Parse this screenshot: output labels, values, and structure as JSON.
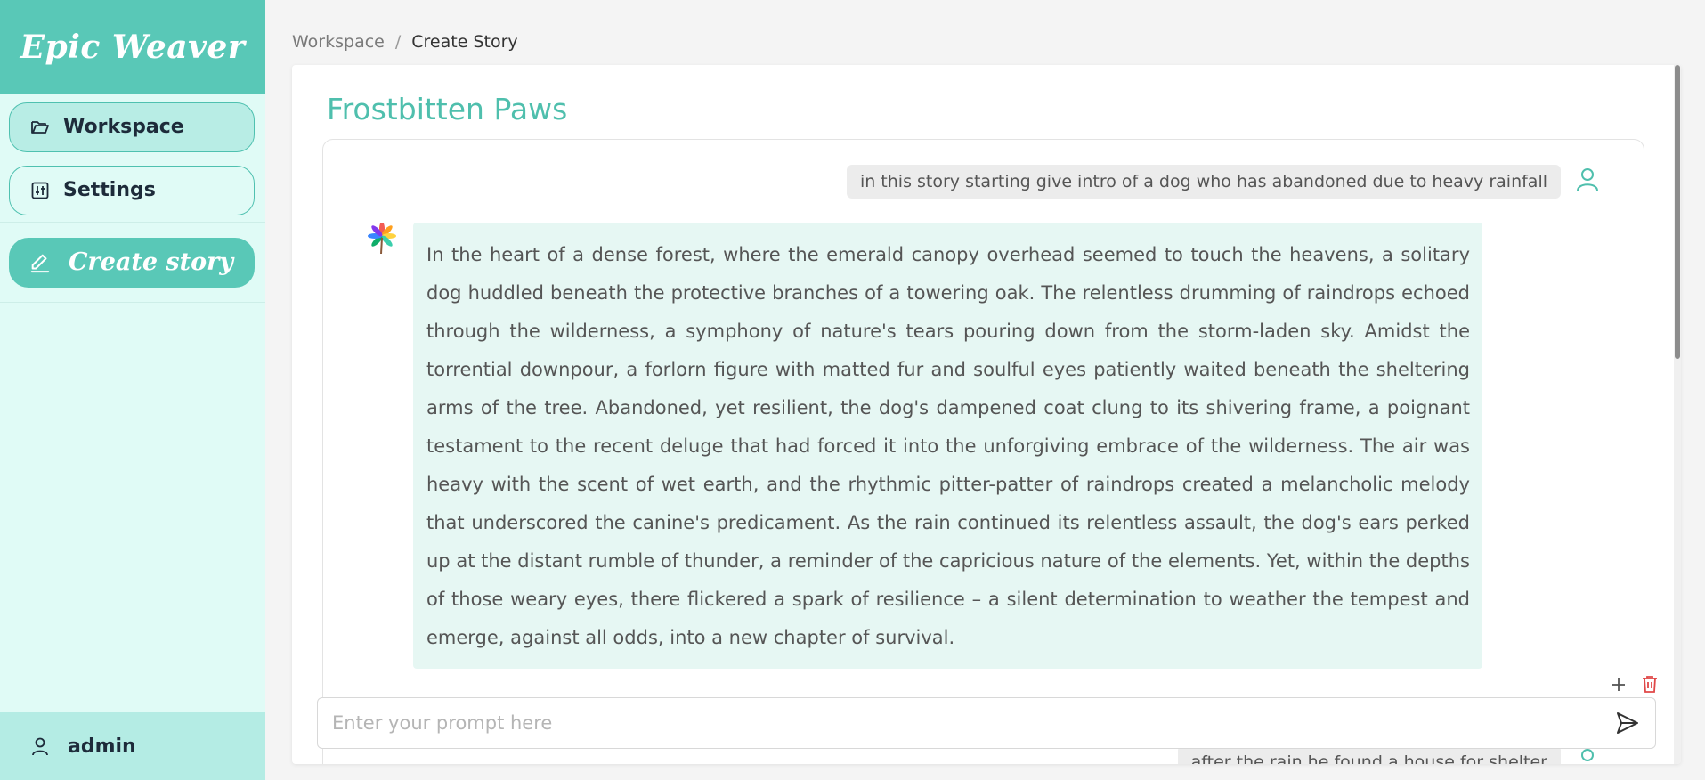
{
  "app": {
    "name": "Epic Weaver"
  },
  "sidebar": {
    "items": [
      {
        "label": "Workspace",
        "icon": "folder-open-icon",
        "active": true
      },
      {
        "label": "Settings",
        "icon": "sliders-icon",
        "active": false
      },
      {
        "label": "Create story",
        "icon": "pencil-icon",
        "active": false
      }
    ],
    "user": {
      "label": "admin",
      "icon": "user-icon"
    }
  },
  "breadcrumb": {
    "parent": "Workspace",
    "separator": "/",
    "current": "Create Story"
  },
  "story": {
    "title": "Frostbitten Paws"
  },
  "chat": {
    "messages": [
      {
        "role": "user",
        "text": "in this story starting give intro of a dog who has abandoned due to heavy rainfall"
      },
      {
        "role": "assistant",
        "text": "In the heart of a dense forest, where the emerald canopy overhead seemed to touch the heavens, a solitary dog huddled beneath the protective branches of a towering oak. The relentless drumming of raindrops echoed through the wilderness, a symphony of nature's tears pouring down from the storm-laden sky. Amidst the torrential downpour, a forlorn figure with matted fur and soulful eyes patiently waited beneath the sheltering arms of the tree. Abandoned, yet resilient, the dog's dampened coat clung to its shivering frame, a poignant testament to the recent deluge that had forced it into the unforgiving embrace of the wilderness. The air was heavy with the scent of wet earth, and the rhythmic pitter-patter of raindrops created a melancholic melody that underscored the canine's predicament. As the rain continued its relentless assault, the dog's ears perked up at the distant rumble of thunder, a reminder of the capricious nature of the elements. Yet, within the depths of those weary eyes, there flickered a spark of resilience – a silent determination to weather the tempest and emerge, against all odds, into a new chapter of survival."
      },
      {
        "role": "user",
        "text": "after the rain he found a house for shelter"
      }
    ]
  },
  "prompt": {
    "placeholder": "Enter your prompt here",
    "value": ""
  },
  "colors": {
    "accent": "#59c8b7",
    "sidebar_bg": "#e0fbf6",
    "bot_bubble": "#e6f7f3",
    "delete": "#e04848"
  }
}
